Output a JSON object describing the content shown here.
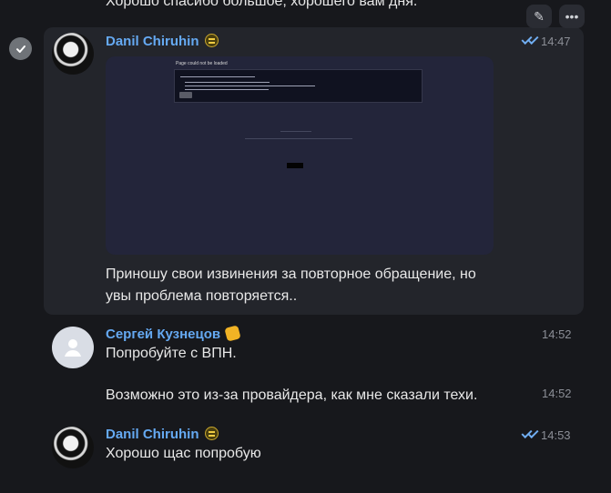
{
  "previous_message": {
    "text": "Хорошо спасибо большое, хорошего вам дня."
  },
  "hover_actions": [
    {
      "icon": "pencil-icon",
      "label": "✎"
    },
    {
      "icon": "more-icon",
      "label": "•••"
    }
  ],
  "messages": [
    {
      "sender": "Danil Chiruhin",
      "time": "14:47",
      "status": "read",
      "preview_title": "Page could not be loaded",
      "text": "Приношу свои извинения за повторное обращение, но увы проблема повторяется.."
    },
    {
      "sender": "Сергей Кузнецов",
      "time": "14:52",
      "text": "Попробуйте с ВПН."
    },
    {
      "time": "14:52",
      "text": "Возможно это из-за провайдера, как мне сказали техи."
    },
    {
      "sender": "Danil Chiruhin",
      "time": "14:53",
      "status": "read",
      "text": "Хорошо щас попробую"
    }
  ],
  "colors": {
    "background": "#17181c",
    "selected_message": "#23252b",
    "sender": "#65a9f2",
    "time": "#8b8e96",
    "checkmarks": "#71aef2"
  }
}
